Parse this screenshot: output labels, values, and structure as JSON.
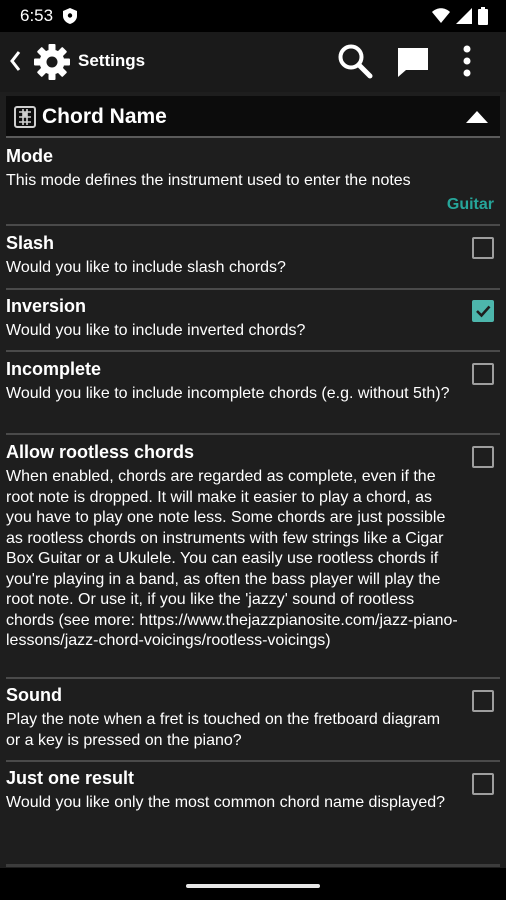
{
  "status": {
    "time": "6:53"
  },
  "toolbar": {
    "title": "Settings"
  },
  "section": {
    "title": "Chord Name"
  },
  "settings": [
    {
      "title": "Mode",
      "description": "This mode defines the instrument used to enter the notes",
      "value": "Guitar"
    },
    {
      "title": "Slash",
      "description": "Would you like to include slash chords?",
      "checked": false
    },
    {
      "title": "Inversion",
      "description": "Would you like to include inverted chords?",
      "checked": true
    },
    {
      "title": "Incomplete",
      "description": "Would you like to include incomplete chords (e.g. without 5th)?",
      "checked": false
    },
    {
      "title": "Allow rootless chords",
      "description": "When enabled, chords are regarded as complete, even if the root note is dropped. It will make it easier to play a chord, as you have to play one note less. Some chords are just possible as rootless chords on instruments with few strings like a Cigar Box Guitar or a Ukulele. You can easily use rootless chords if you're playing in a band, as often the bass player will play the root note. Or use it, if you like the 'jazzy' sound of rootless chords (see more: https://www.thejazzpianosite.com/jazz-piano-lessons/jazz-chord-voicings/rootless-voicings)",
      "checked": false
    },
    {
      "title": "Sound",
      "description": "Play the note when a fret is touched on the fretboard diagram or a key is pressed on the piano?",
      "checked": false
    },
    {
      "title": "Just one result",
      "description": "Would you like only the most common chord name displayed?",
      "checked": false
    }
  ],
  "colors": {
    "accent": "#26a69a",
    "checkbox_checked": "#4db6ac",
    "background": "#1e1e1e"
  }
}
